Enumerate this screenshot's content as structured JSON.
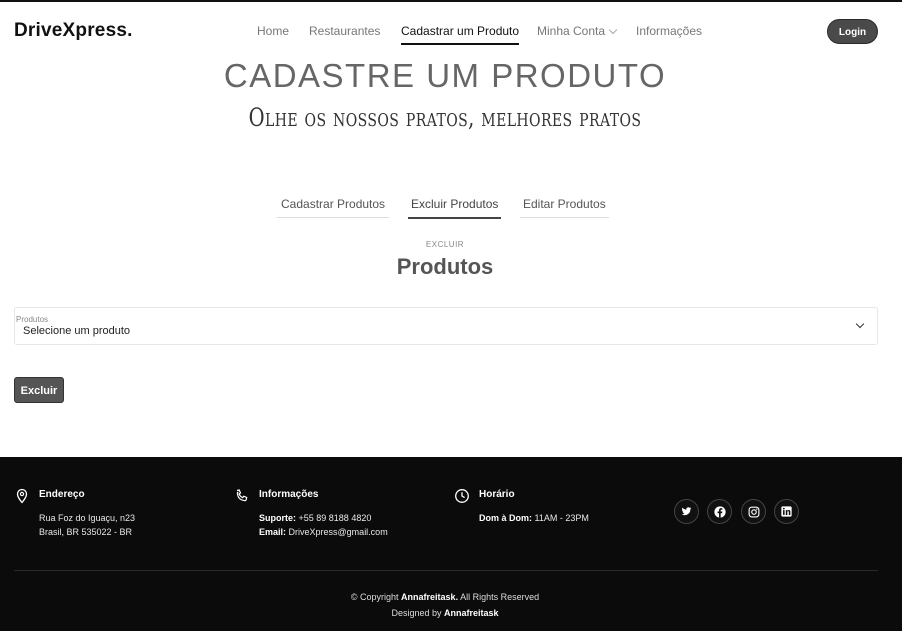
{
  "header": {
    "brand": "DriveXpress",
    "brand_dot": ".",
    "nav": [
      "Home",
      "Restaurantes",
      "Cadastrar um Produto",
      "Minha Conta",
      "Informações"
    ],
    "login_label": "Login"
  },
  "hero": {
    "title": "CADASTRE UM PRODUTO",
    "subtitle": "Olhe os nossos pratos, melhores pratos"
  },
  "tabs": [
    "Cadastrar Produtos",
    "Excluir Produtos",
    "Editar Produtos"
  ],
  "section": {
    "kicker": "EXCLUIR",
    "title": "Produtos"
  },
  "form": {
    "select_label": "Produtos",
    "select_value": "Selecione um produto",
    "delete_label": "Excluir"
  },
  "footer": {
    "address": {
      "title": "Endereço",
      "line1": "Rua Foz do Iguaçu, n23",
      "line2": "Brasil, BR 535022 - BR"
    },
    "info": {
      "title": "Informações",
      "support_label": "Suporte:",
      "support_value": "+55 89 8188 4820",
      "email_label": "Email:",
      "email_value": "DriveXpress@gmail.com"
    },
    "hours": {
      "title": "Horário",
      "days_label": "Dom à Dom:",
      "days_value": "11AM - 23PM"
    },
    "social_icons": [
      "twitter-icon",
      "facebook-icon",
      "instagram-icon",
      "linkedin-icon"
    ],
    "copyright_prefix": "© Copyright",
    "copyright_owner": "Annafreitask.",
    "copyright_suffix": "All Rights Reserved",
    "designed_prefix": "Designed by",
    "designed_owner": "Annafreitask"
  }
}
